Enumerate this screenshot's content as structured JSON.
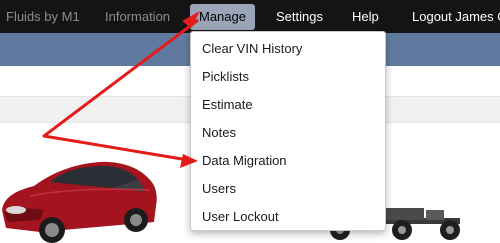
{
  "nav": {
    "brand": "Fluids by M1",
    "information": "Information",
    "manage": "Manage",
    "settings": "Settings",
    "help": "Help",
    "logout": "Logout James O"
  },
  "manage_menu": {
    "items": [
      "Clear VIN History",
      "Picklists",
      "Estimate",
      "Notes",
      "Data Migration",
      "Users",
      "User Lockout"
    ]
  },
  "colors": {
    "nav_background": "#141414",
    "active_tab": "#9aa6b8",
    "header_bar": "#5f7a9e",
    "annotation_arrow": "#e31b1b",
    "car_body": "#a3141f"
  },
  "icons": {
    "car": "red-sedan-image",
    "chassis": "truck-chassis-image"
  }
}
